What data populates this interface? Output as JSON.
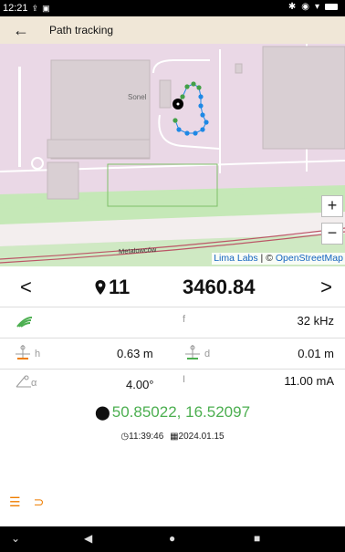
{
  "status_bar": {
    "time": "12:21",
    "icons": [
      "upload-icon",
      "sim-icon",
      "bluetooth-icon",
      "location-icon",
      "wifi-icon",
      "battery-icon"
    ]
  },
  "map": {
    "title": "Path tracking",
    "building_label": "Sonel",
    "street_label": "Metalowców",
    "attribution_brand": "Lima Labs",
    "attribution_sep": " | © ",
    "attribution_osm": "OpenStreetMap",
    "zoom_in": "+",
    "zoom_out": "−"
  },
  "measurement": {
    "prev": "<",
    "next": ">",
    "point_number": "11",
    "distance_value": "3460.84",
    "f_label": "f",
    "f_value": "32 kHz",
    "h_label": "h",
    "h_value": "0.63 m",
    "d_label": "d",
    "d_value": "0.01 m",
    "alpha_label": "α",
    "alpha_value": "4.00°",
    "i_label": "I",
    "i_value": "11.00 mA",
    "coordinates": "50.85022, 16.52097",
    "time": "11:39:46",
    "date": "2024.01.15"
  },
  "colors": {
    "accent_green": "#4caf50",
    "accent_orange": "#ef7d00",
    "track_green": "#43a047",
    "track_blue": "#1e88e5"
  }
}
